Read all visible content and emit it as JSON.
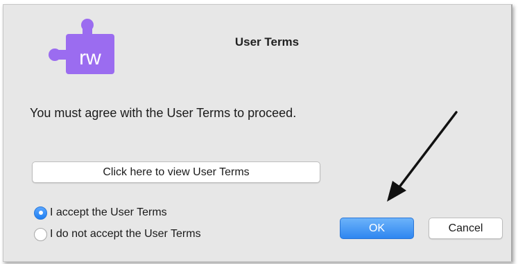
{
  "dialog": {
    "title": "User Terms",
    "app_icon": {
      "name": "puzzle-piece-icon",
      "text": "rw",
      "color": "#9b6cf0"
    },
    "message": "You must agree with the User Terms to proceed.",
    "view_terms_label": "Click here to view User Terms",
    "options": [
      {
        "label": "I accept the User Terms",
        "selected": true
      },
      {
        "label": "I do not accept the User Terms",
        "selected": false
      }
    ],
    "ok_label": "OK",
    "cancel_label": "Cancel"
  },
  "colors": {
    "accent": "#2f86f0",
    "icon_purple": "#9b6cf0",
    "dialog_bg": "#e7e7e7"
  },
  "annotation": {
    "name": "arrow-pointer-icon",
    "color": "#111111"
  }
}
